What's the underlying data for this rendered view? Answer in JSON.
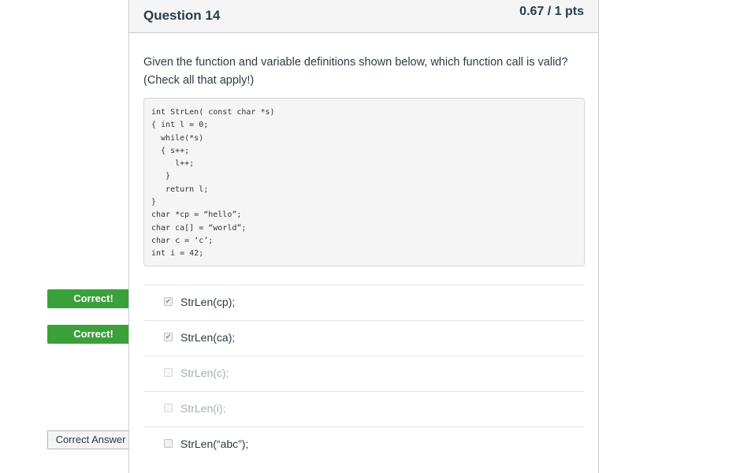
{
  "question": {
    "title": "Question 14",
    "points": "0.67 / 1 pts",
    "text_line1": "Given the function and variable definitions shown below, which function call is valid?",
    "text_line2": "(Check all that apply!)",
    "code": "int StrLen( const char *s)\n{ int l = 0;\n  while(*s)\n  { s++;\n     l++;\n   }\n   return l;\n}\nchar *cp = “hello”;\nchar ca[] = “world”;\nchar c = ‘c’;\nint i = 42;"
  },
  "answers": [
    {
      "label": "StrLen(cp);",
      "checked": true,
      "flag": "Correct!"
    },
    {
      "label": "StrLen(ca);",
      "checked": true,
      "flag": "Correct!"
    },
    {
      "label": "StrLen(c);",
      "checked": false,
      "flag": ""
    },
    {
      "label": "StrLen(i);",
      "checked": false,
      "flag": ""
    },
    {
      "label": "StrLen(“abc”);",
      "checked": false,
      "flag": "Correct Answer"
    }
  ],
  "check_glyph": "✔",
  "colors": {
    "correct_flag": "#3aa13a",
    "answer_flag_bg": "#f5f5f5",
    "text": "#2d3b45"
  },
  "icons": {
    "checkbox_checked": "checkbox-checked-icon",
    "checkbox_empty": "checkbox-empty-icon"
  }
}
